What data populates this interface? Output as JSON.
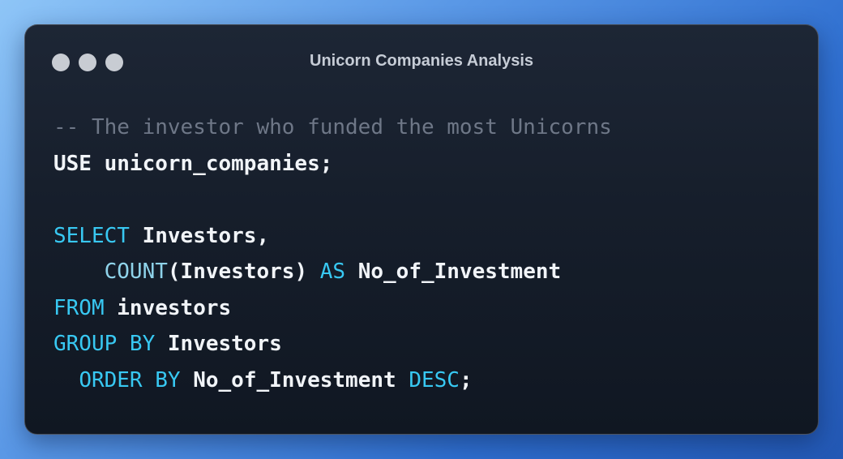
{
  "window": {
    "title": "Unicorn Companies Analysis",
    "traffic_lights": [
      "close-dot",
      "minimize-dot",
      "zoom-dot"
    ]
  },
  "code": {
    "language": "SQL",
    "lines": [
      [
        {
          "t": "-- The investor who funded the most Unicorns",
          "k": "comment"
        }
      ],
      [
        {
          "t": "USE unicorn_companies;",
          "k": "plain"
        }
      ],
      [],
      [
        {
          "t": "SELECT",
          "k": "kw"
        },
        {
          "t": " Investors,",
          "k": "plain"
        }
      ],
      [
        {
          "t": "    ",
          "k": "plain"
        },
        {
          "t": "COUNT",
          "k": "fn"
        },
        {
          "t": "(Investors) ",
          "k": "plain"
        },
        {
          "t": "AS",
          "k": "kw"
        },
        {
          "t": " No_of_Investment",
          "k": "plain"
        }
      ],
      [
        {
          "t": "FROM",
          "k": "kw"
        },
        {
          "t": " investors",
          "k": "plain"
        }
      ],
      [
        {
          "t": "GROUP BY",
          "k": "kw"
        },
        {
          "t": " Investors",
          "k": "plain"
        }
      ],
      [
        {
          "t": "  ",
          "k": "plain"
        },
        {
          "t": "ORDER BY",
          "k": "kw"
        },
        {
          "t": " No_of_Investment ",
          "k": "plain"
        },
        {
          "t": "DESC",
          "k": "kw"
        },
        {
          "t": ";",
          "k": "plain"
        }
      ]
    ]
  }
}
